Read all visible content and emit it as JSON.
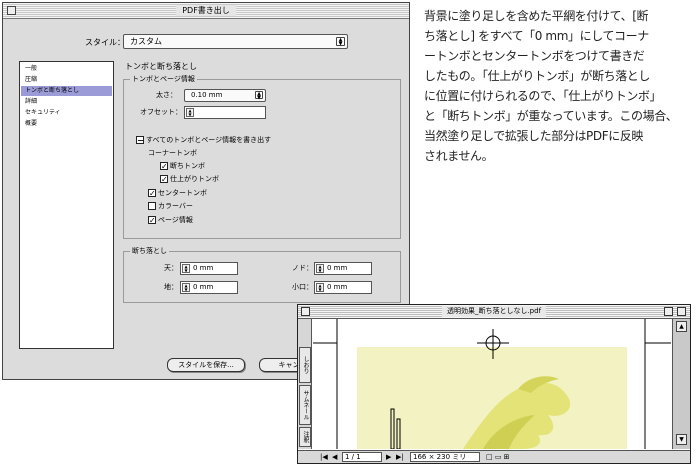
{
  "dialog": {
    "title": "PDF書き出し",
    "style_label": "スタイル：",
    "style_value": "カスタム",
    "nav_items": [
      {
        "label": "一般",
        "selected": false
      },
      {
        "label": "圧縮",
        "selected": false
      },
      {
        "label": "トンボと断ち落とし",
        "selected": true
      },
      {
        "label": "詳細",
        "selected": false
      },
      {
        "label": "セキュリティ",
        "selected": false
      },
      {
        "label": "概要",
        "selected": false
      }
    ],
    "section_title": "トンボと断ち落とし",
    "marks_group": {
      "title": "トンボとページ情報",
      "weight_label": "太さ：",
      "weight_value": "0.10 mm",
      "offset_label": "オフセット：",
      "all_marks_label": "すべてのトンボとページ情報を書き出す",
      "corner_label": "コーナートンボ",
      "crop_marks_label": "断ちトンボ",
      "trim_marks_label": "仕上がりトンボ",
      "registration_marks_label": "センタートンボ",
      "color_bars_label": "カラーバー",
      "page_info_label": "ページ情報"
    },
    "bleed_group": {
      "title": "断ち落とし",
      "top_label": "天：",
      "top_value": "0 mm",
      "bottom_label": "地：",
      "bottom_value": "0 mm",
      "inside_label": "ノド：",
      "inside_value": "0 mm",
      "outside_label": "小口：",
      "outside_value": "0 mm"
    },
    "save_style_button": "スタイルを保存...",
    "cancel_button": "キャン"
  },
  "article": {
    "lines": [
      "背景に塗り足しを含めた平網を付けて、[断",
      "ち落とし] をすべて「0 mm」にしてコーナ",
      "ートンボとセンタートンボをつけて書きだ",
      "したもの。「仕上がりトンボ」が断ち落とし",
      "に位置に付けられるので、「仕上がりトンボ」",
      "と「断ちトンボ」が重なっています。この場合、",
      "当然塗り足しで拡張した部分はPDFに反映",
      "されません。"
    ]
  },
  "preview": {
    "title": "透明効果_断ち落としなし.pdf",
    "side_tabs": [
      "しおり",
      "サムネール",
      "注釈"
    ],
    "page_indicator": "1 / 1",
    "page_size": "166 × 230 ミリ"
  }
}
